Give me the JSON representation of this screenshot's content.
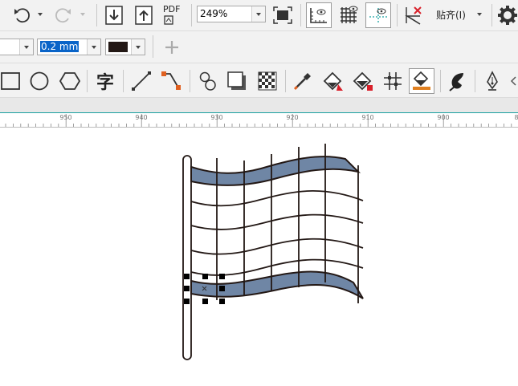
{
  "toolbar": {
    "zoom_value": "249%",
    "pdf_label": "PDF",
    "snap_label": "贴齐(I)"
  },
  "property_bar": {
    "outline_width": "0.2 mm",
    "outline_color": "#231815"
  },
  "toolbox": {
    "text_tool_glyph": "字"
  },
  "ruler": {
    "labels": [
      "950",
      "940",
      "930",
      "920",
      "910",
      "900",
      "8"
    ]
  },
  "colors": {
    "flag_band_fill": "#6f86a5",
    "stroke": "#231815",
    "accent_teal": "#18a0a0",
    "selection_blue": "#0a64c8"
  },
  "icons": [
    "undo-icon",
    "redo-icon",
    "import-icon",
    "export-icon",
    "publish-pdf-icon",
    "full-screen-preview-icon",
    "show-rulers-icon",
    "show-grid-icon",
    "show-guidelines-icon",
    "snap-off-icon",
    "options-gear-icon",
    "add-icon",
    "rectangle-tool-icon",
    "ellipse-tool-icon",
    "polygon-tool-icon",
    "text-tool-icon",
    "straight-line-icon",
    "connector-icon",
    "shape-tool-icon",
    "drop-shadow-icon",
    "transparency-icon",
    "eyedropper-icon",
    "interactive-fill-icon",
    "smart-fill-icon",
    "mesh-fill-icon",
    "attributes-eyedropper-icon",
    "pen-icon",
    "fountain-pen-icon"
  ]
}
